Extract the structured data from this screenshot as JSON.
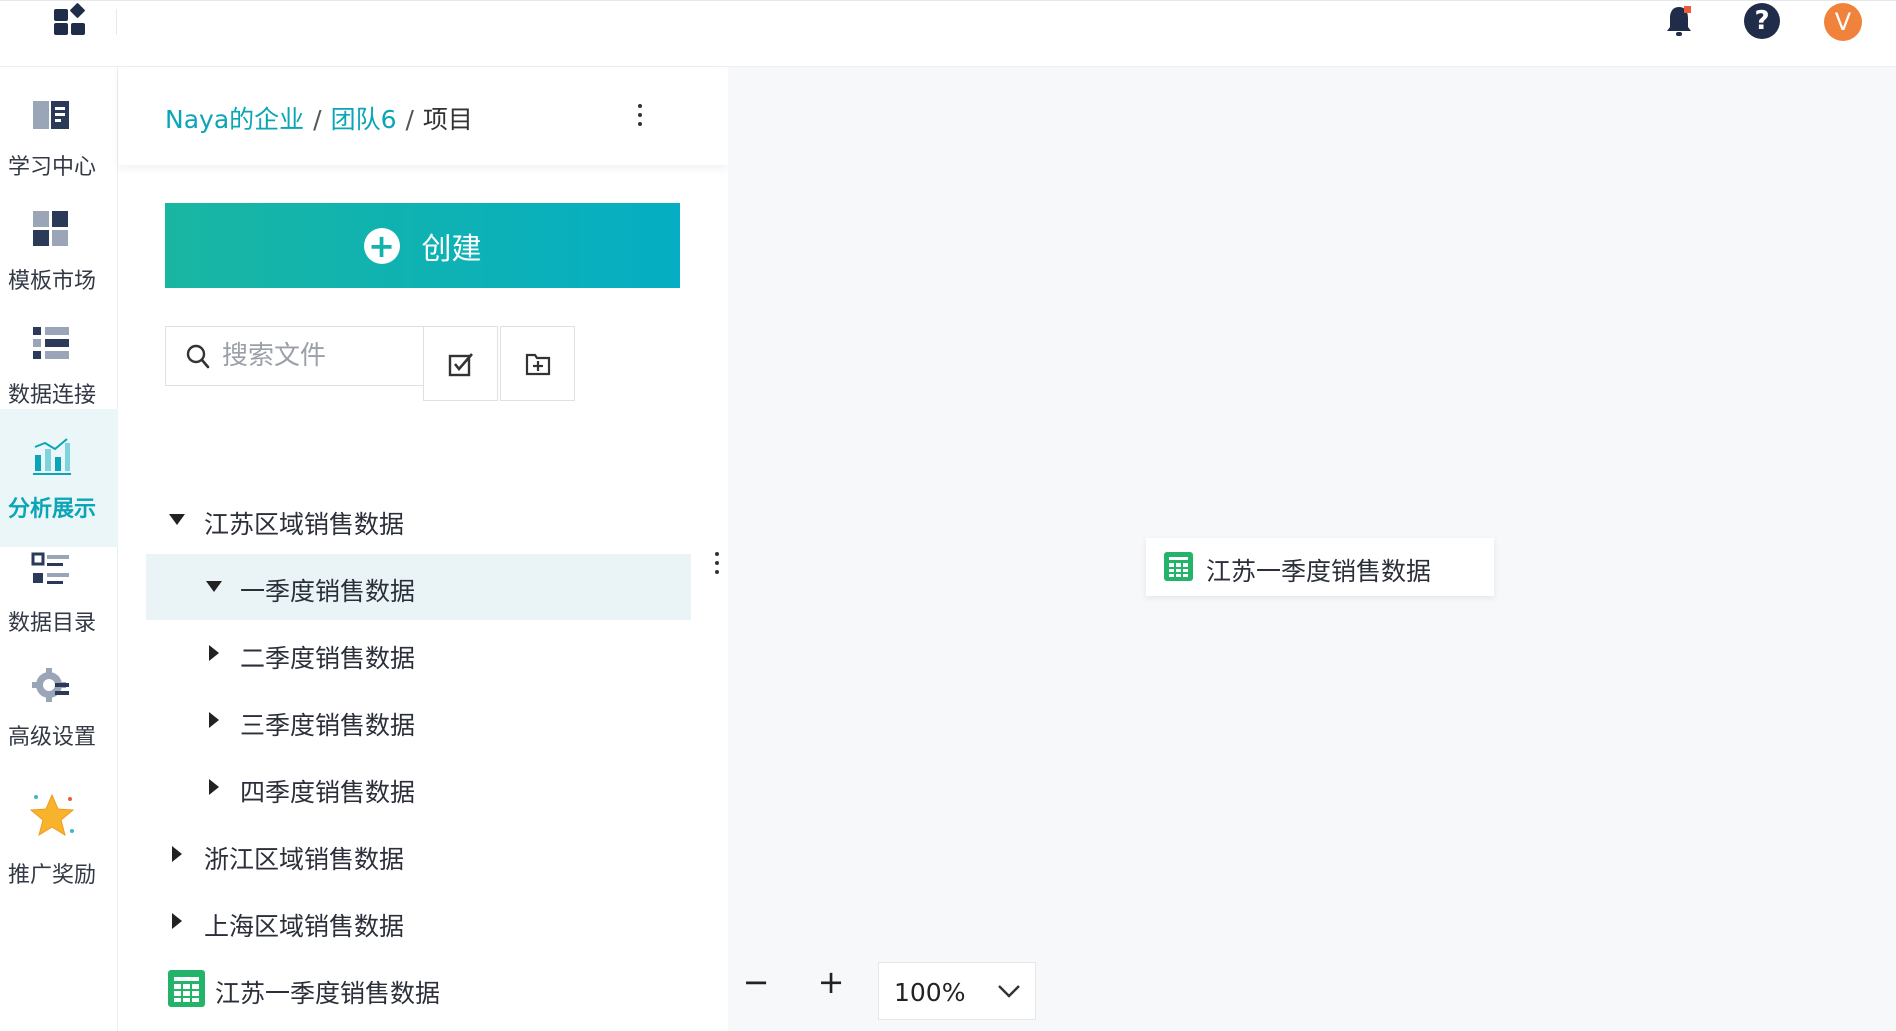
{
  "header": {
    "logo_icon": "apps-grid-icon",
    "bell_icon": "bell-icon",
    "help_label": "?",
    "avatar_initial": "V",
    "avatar_color": "#f0823c"
  },
  "sidenav": {
    "items": [
      {
        "label": "学习中心",
        "icon": "book-icon",
        "active": false
      },
      {
        "label": "模板市场",
        "icon": "template-icon",
        "active": false
      },
      {
        "label": "数据连接",
        "icon": "connection-icon",
        "active": false
      },
      {
        "label": "分析展示",
        "icon": "chart-icon",
        "active": true
      },
      {
        "label": "数据目录",
        "icon": "catalog-icon",
        "active": false
      },
      {
        "label": "高级设置",
        "icon": "gear-icon",
        "active": false
      },
      {
        "label": "推广奖励",
        "icon": "star-icon",
        "active": false
      }
    ]
  },
  "panel": {
    "breadcrumb": {
      "org": "Naya的企业",
      "team": "团队6",
      "current": "项目",
      "sep": "/"
    },
    "create_label": "创建",
    "search_placeholder": "搜索文件",
    "tree": [
      {
        "label": "江苏区域销售数据",
        "level": 0,
        "expanded": true,
        "type": "folder"
      },
      {
        "label": "一季度销售数据",
        "level": 1,
        "expanded": true,
        "type": "folder",
        "selected": true
      },
      {
        "label": "二季度销售数据",
        "level": 1,
        "expanded": false,
        "type": "folder"
      },
      {
        "label": "三季度销售数据",
        "level": 1,
        "expanded": false,
        "type": "folder"
      },
      {
        "label": "四季度销售数据",
        "level": 1,
        "expanded": false,
        "type": "folder"
      },
      {
        "label": "浙江区域销售数据",
        "level": 0,
        "expanded": false,
        "type": "folder"
      },
      {
        "label": "上海区域销售数据",
        "level": 0,
        "expanded": false,
        "type": "folder"
      },
      {
        "label": "江苏一季度销售数据",
        "level": 0,
        "type": "sheet"
      }
    ]
  },
  "canvas": {
    "node_label": "江苏一季度销售数据",
    "zoom_minus": "−",
    "zoom_plus": "+",
    "zoom_value": "100%"
  },
  "colors": {
    "accent": "#0aa5b6",
    "create_gradient_start": "#19b6a2",
    "create_gradient_end": "#05aec3",
    "sheet_green": "#23b46a"
  }
}
